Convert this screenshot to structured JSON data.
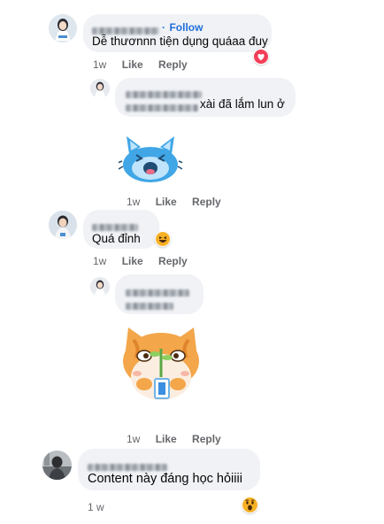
{
  "comments": [
    {
      "follow_label": "Follow",
      "follow_sep": "·",
      "text": "Dễ thươnnn tiện dụng quáaa đuy",
      "time": "1w",
      "like_label": "Like",
      "reply_label": "Reply",
      "reaction_icon": "love-reaction-icon",
      "replies": [
        {
          "text": "xài đã lắm lun ở",
          "time": "1w",
          "like_label": "Like",
          "reply_label": "Reply",
          "sticker": "blue-cat-sticker"
        }
      ]
    },
    {
      "text": "Quá đỉnh",
      "time": "1w",
      "like_label": "Like",
      "reply_label": "Reply",
      "reaction_icon": "haha-reaction-icon",
      "replies": [
        {
          "time": "1w",
          "like_label": "Like",
          "reply_label": "Reply",
          "sticker": "orange-cat-sticker"
        }
      ]
    },
    {
      "text": "Content này đáng học hỏiiii",
      "time": "1 w",
      "reaction_icon": "wow-reaction-icon"
    }
  ],
  "colors": {
    "bubble": "#f0f2f5",
    "link": "#216fdb",
    "meta": "#65676b",
    "love": "#f33e58",
    "haha": "#f7b125"
  }
}
